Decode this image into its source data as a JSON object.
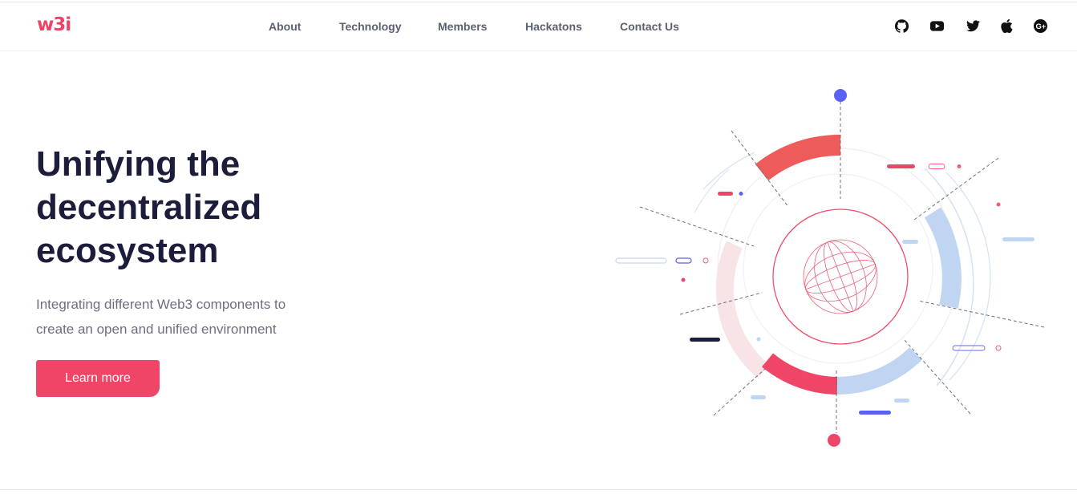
{
  "brand": {
    "logo_text": "w3i",
    "accent_color": "#ee4266"
  },
  "nav": {
    "items": [
      {
        "label": "About"
      },
      {
        "label": "Technology"
      },
      {
        "label": "Members"
      },
      {
        "label": "Hackatons"
      },
      {
        "label": "Contact Us"
      }
    ]
  },
  "social": {
    "icons": [
      "github-icon",
      "youtube-icon",
      "twitter-icon",
      "apple-icon",
      "google-plus-icon"
    ]
  },
  "hero": {
    "title_lines": [
      "Unifying the",
      "decentralized",
      "ecosystem"
    ],
    "subtitle_lines": [
      "Integrating different Web3 components to",
      "create an open and unified environment"
    ],
    "cta_label": "Learn more"
  },
  "colors": {
    "title": "#1c1d3a",
    "nav_text": "#5b6073",
    "subtitle": "#6c6f80",
    "red": "#ef4668",
    "coral": "#ee5b5b",
    "blue_light": "#bfd5f2",
    "indigo": "#5b61f2"
  }
}
